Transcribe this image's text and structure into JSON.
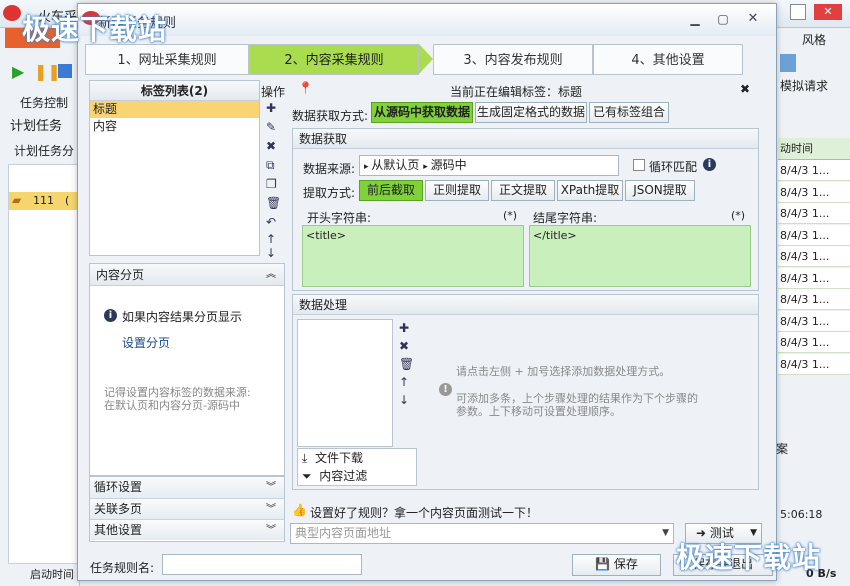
{
  "background": {
    "app_title": "火车采",
    "menu_right": "风格",
    "task_control": "任务控制",
    "plan_task": "计划任务",
    "plan_task_col": "计划任务分",
    "row_item": "111",
    "row_item_suffix": "(",
    "import_label": "模拟请求",
    "time_col": "动时间",
    "time_rows": [
      "8/4/3 1...",
      "8/4/3 1...",
      "8/4/3 1...",
      "8/4/3 1...",
      "8/4/3 1...",
      "8/4/3 1...",
      "8/4/3 1...",
      "8/4/3 1...",
      "8/4/3 1...",
      "8/4/3 1..."
    ],
    "side_text": "案",
    "clock": "5:06:18",
    "speed": "0 B/s",
    "status_left": "启动时间",
    "watermark_left": "极速下载站",
    "watermark_right": "极速下载站"
  },
  "dialog": {
    "title": "新建任务规则",
    "steps": [
      "1、网址采集规则",
      "2、内容采集规则",
      "3、内容发布规则",
      "4、其他设置"
    ],
    "active_step": 1,
    "tag_list": {
      "header": "标签列表(2)",
      "items": [
        "标题",
        "内容"
      ],
      "ops_label": "操作"
    },
    "editing": {
      "label": "当前正在编辑标签：标题",
      "get_mode_label": "数据获取方式:",
      "get_modes": [
        "从源码中获取数据",
        "生成固定格式的数据",
        "已有标签组合"
      ]
    },
    "data_get": {
      "header": "数据获取",
      "source_label": "数据来源:",
      "source_path": [
        "从默认页",
        "源码中"
      ],
      "loop_match": "循环匹配",
      "extract_label": "提取方式:",
      "extract_modes": [
        "前后截取",
        "正则提取",
        "正文提取",
        "XPath提取",
        "JSON提取"
      ],
      "start_label": "开头字符串:",
      "end_label": "结尾字符串:",
      "star": "(*)",
      "start_value": "<title>",
      "end_value": "</title>"
    },
    "paging": {
      "header": "内容分页",
      "info": "如果内容结果分页显示",
      "link": "设置分页",
      "note_line1": "记得设置内容标签的数据来源:",
      "note_line2": "在默认页和内容分页-源码中"
    },
    "accordions": [
      "循环设置",
      "关联多页",
      "其他设置"
    ],
    "process": {
      "header": "数据处理",
      "hint": "请点击左侧 + 加号选择添加数据处理方式。",
      "tip_line1": "可添加多条，上个步骤处理的结果作为下个步骤的",
      "tip_line2": "参数。上下移动可设置处理顺序。",
      "menu": [
        "文件下载",
        "内容过滤"
      ]
    },
    "test": {
      "prompt": "设置好了规则？拿一个内容页面测试一下！",
      "placeholder": "典型内容页面地址",
      "button": "测试"
    },
    "footer": {
      "rule_name_label": "任务规则名:",
      "save": "保存",
      "save_exit": "保存并退出"
    }
  }
}
